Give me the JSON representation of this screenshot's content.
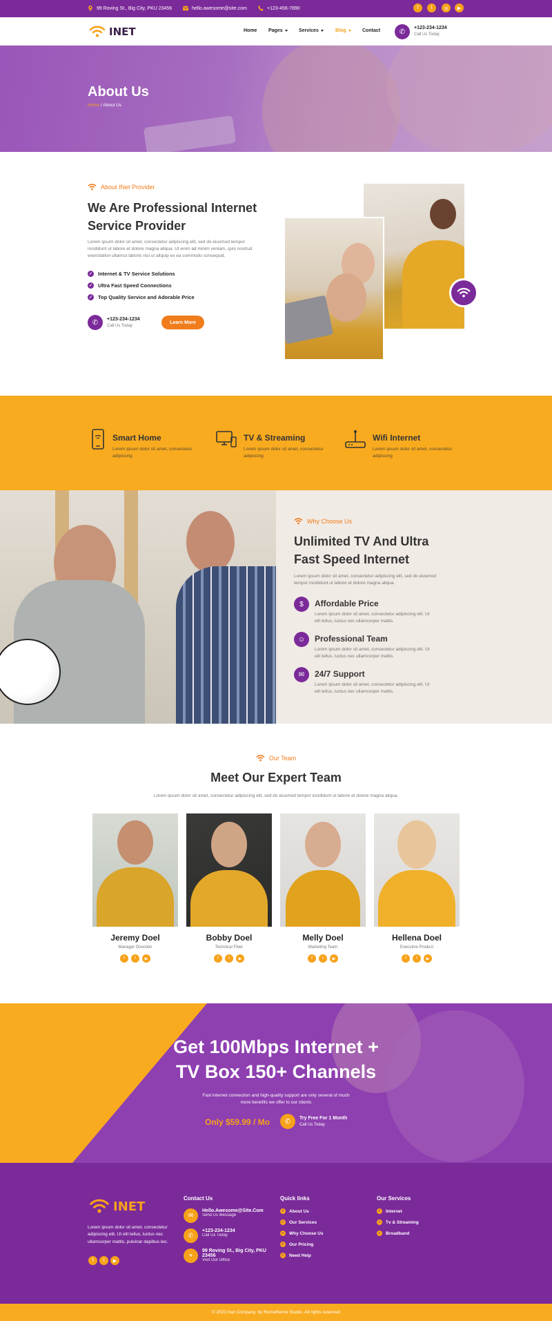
{
  "topbar": {
    "address": "99 Roving St., Big City, PKU 23456",
    "email": "hello.awesome@site.com",
    "phone": "+123-456-7890",
    "social": [
      "f",
      "t",
      "ig",
      "yt"
    ]
  },
  "nav": {
    "logo": "INET",
    "links": [
      "Home",
      "Pages",
      "Services",
      "Blog",
      "Contact"
    ],
    "active": "Blog",
    "call_number": "+123-234-1234",
    "call_label": "Call Us Today"
  },
  "hero": {
    "title": "About Us",
    "crumb_home": "Home",
    "crumb_sep": " / ",
    "crumb_current": "About Us"
  },
  "about": {
    "eyebrow": "About INet Provider",
    "title_line1": "We Are Professional Internet",
    "title_line2": "Service Provider",
    "body": "Lorem ipsum dolor sit amet, consectetur adipiscing elit, sed do eiusmod tempor incididunt ut labore et dolore magna aliqua. Ut enim ad minim veniam, quis nostrud exercitation ullamco laboris nisi ut aliquip ex ea commodo consequat.",
    "checks": [
      "Internet & TV Service Solutions",
      "Ultra Fast Speed Connections",
      "Top Quality Service and Adorable Price"
    ],
    "phone": "+123-234-1234",
    "phone_label": "Call Us Today",
    "button": "Learn More"
  },
  "features": [
    {
      "icon": "smartphone-icon",
      "title": "Smart Home",
      "text": "Lorem ipsum dolor sit amet, consectetur adipiscing"
    },
    {
      "icon": "tv-icon",
      "title": "TV & Streaming",
      "text": "Lorem ipsum dolor sit amet, consectetur adipiscing"
    },
    {
      "icon": "router-icon",
      "title": "Wifi Internet",
      "text": "Lorem ipsum dolor sit amet, consectetur adipiscing"
    }
  ],
  "why": {
    "eyebrow": "Why Choose Us",
    "title_line1": "Unlimited TV And Ultra",
    "title_line2": "Fast Speed Internet",
    "body": "Lorem ipsum dolor sit amet, consectetur adipiscing elit, sed do eiusmod tempor incididunt ut labore et dolore magna aliqua.",
    "items": [
      {
        "title": "Affordable Price",
        "text": "Lorem ipsum dolor sit amet, consectetur adipiscing elit. Ut elit tellus, luctus nec ullamcorper mattis."
      },
      {
        "title": "Professional Team",
        "text": "Lorem ipsum dolor sit amet, consectetur adipiscing elit. Ut elit tellus, luctus nec ullamcorper mattis."
      },
      {
        "title": "24/7 Support",
        "text": "Lorem ipsum dolor sit amet, consectetur adipiscing elit. Ut elit tellus, luctus nec ullamcorper mattis."
      }
    ]
  },
  "team": {
    "eyebrow": "Our Team",
    "title": "Meet Our Expert Team",
    "body": "Lorem ipsum dolor sit amet, consectetur adipiscing elit, sed do eiusmod tempor incididunt ut labore et dolore magna aliqua.",
    "members": [
      {
        "name": "Jeremy Doel",
        "role": "Manager Direction"
      },
      {
        "name": "Bobby Doel",
        "role": "Technical Fiber"
      },
      {
        "name": "Melly Doel",
        "role": "Marketing Team"
      },
      {
        "name": "Hellena Doel",
        "role": "Executive Product"
      }
    ]
  },
  "promo": {
    "title_line1": "Get 100Mbps Internet +",
    "title_line2": "TV Box 150+ Channels",
    "body_line1": "Fast internet connection and high-quality support are only several of much",
    "body_line2": "more benefits we offer to our clients",
    "price": "Only $59.99 / Mo",
    "cta_title": "Try Free For 1 Month",
    "cta_sub": "Call Us Today"
  },
  "footer": {
    "logo": "INET",
    "about": "Lorem ipsum dolor sit amet, consectetur adipiscing elit. Ut elit tellus, luctus nec ullamcorper mattis, pulvinar dapibus leo.",
    "contact_title": "Contact Us",
    "contacts": [
      {
        "title": "Hello.Awesome@Site.Com",
        "sub": "Send Us Message"
      },
      {
        "title": "+123-234-1234",
        "sub": "Call Us Today"
      },
      {
        "title": "99 Roving St., Big City, PKU 23456",
        "sub": "Visit Our Office"
      }
    ],
    "quick_title": "Quick links",
    "quick": [
      "About Us",
      "Our Services",
      "Why Choose Us",
      "Our Pricing",
      "Need Help"
    ],
    "services_title": "Our Services",
    "services": [
      "Internet",
      "Tv & Streaming",
      "Broadband"
    ],
    "copyright": "© 2023 Inet Company. by Rometheme Studio. All rights reserved"
  },
  "colors": {
    "primary": "#7b2a9a",
    "accent": "#f7a21b",
    "button": "#f07c1b"
  }
}
